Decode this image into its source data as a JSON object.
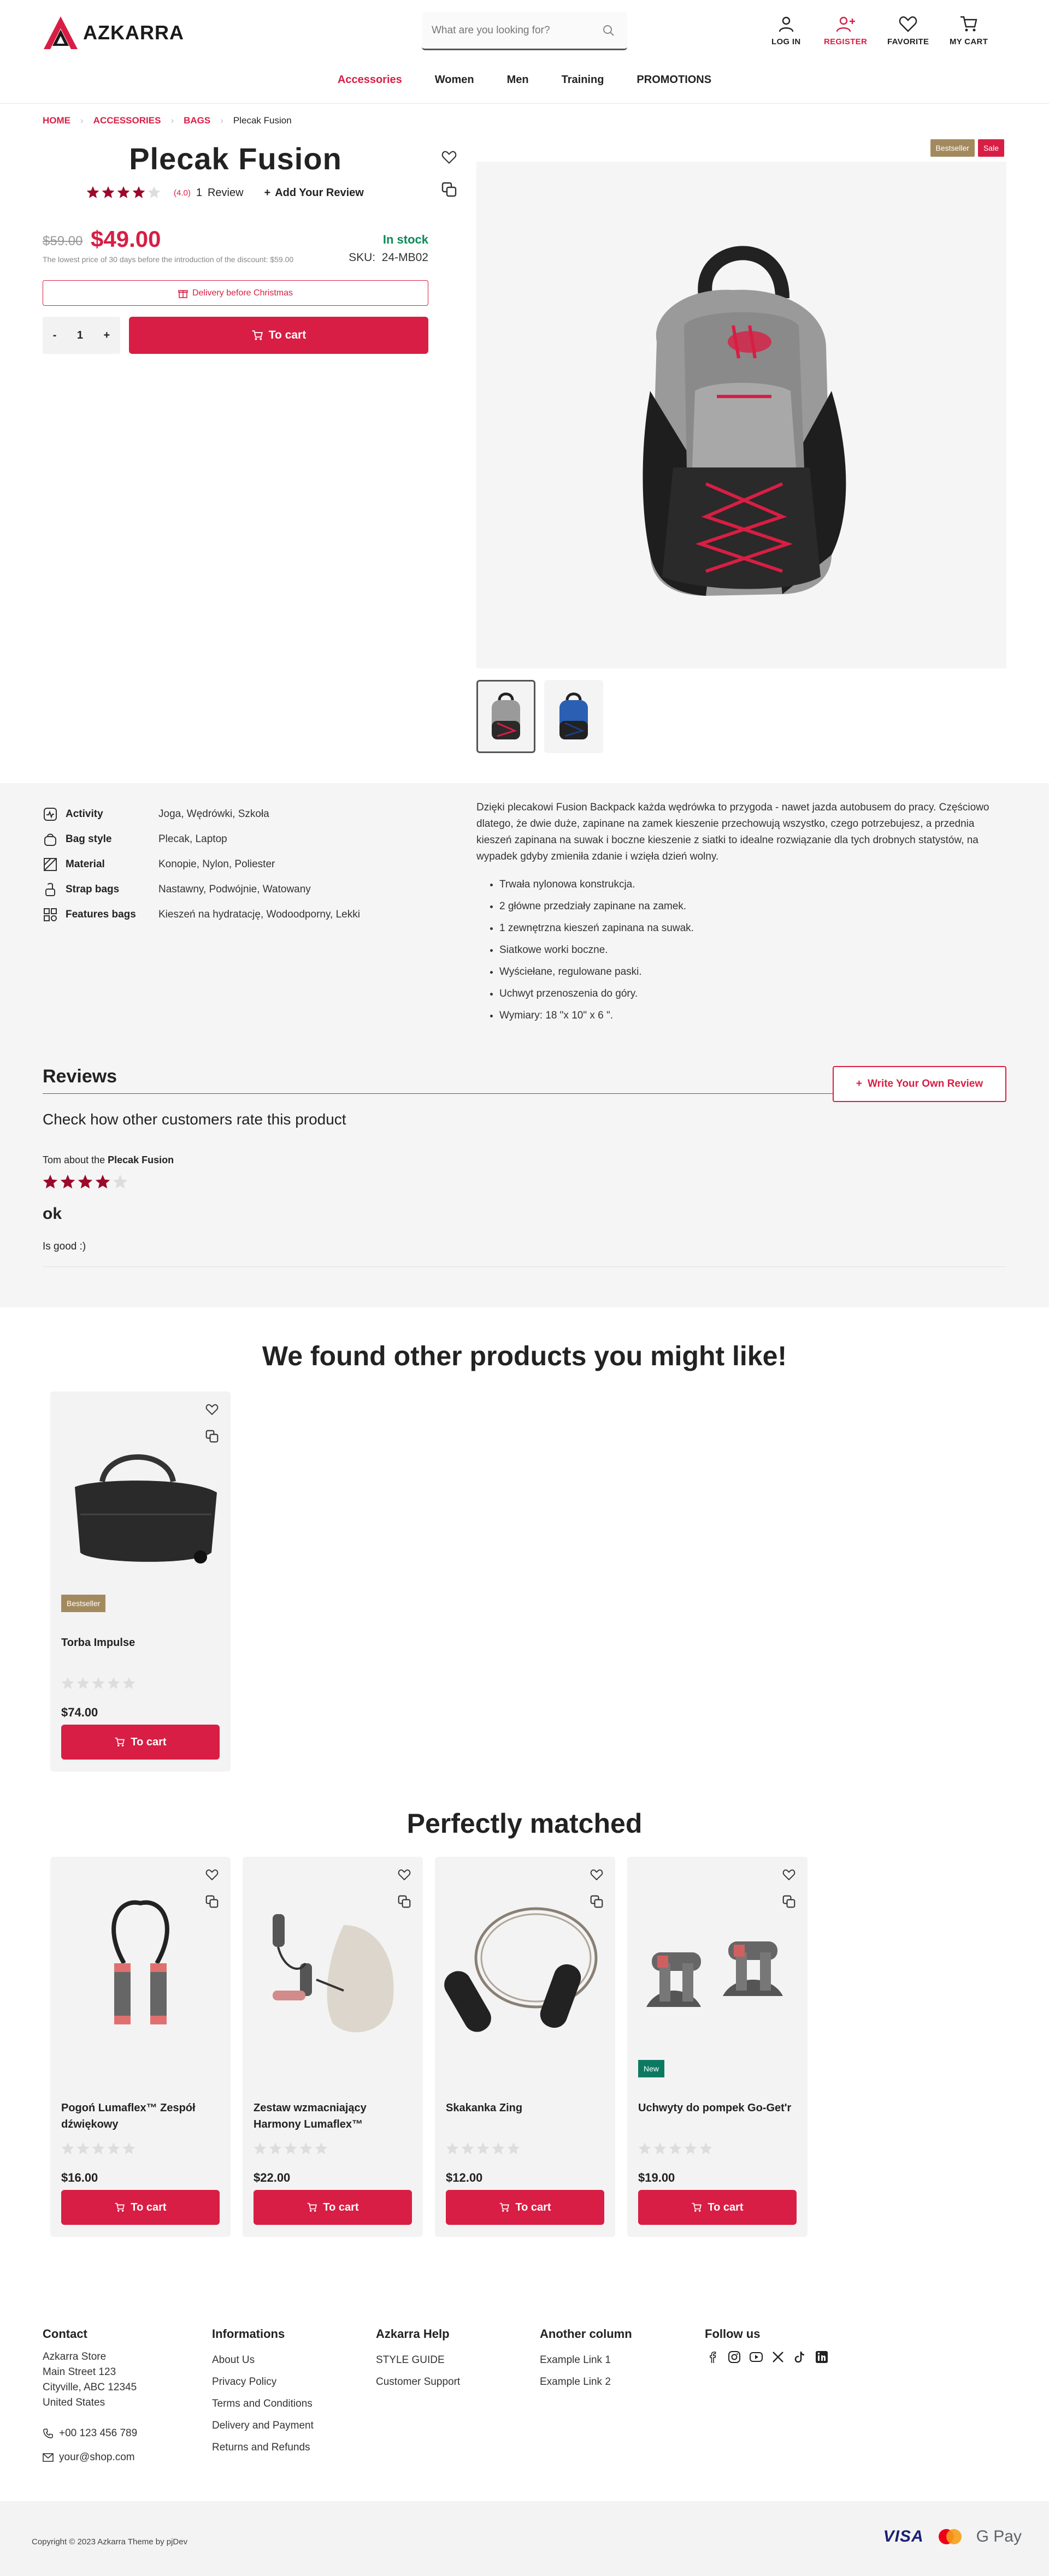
{
  "header": {
    "brand": "AZKARRA",
    "search_placeholder": "What are you looking for?",
    "actions": [
      {
        "label": "LOG IN",
        "icon": "user-icon"
      },
      {
        "label": "REGISTER",
        "icon": "user-plus-icon"
      },
      {
        "label": "FAVORITE",
        "icon": "heart-icon"
      },
      {
        "label": "MY CART",
        "icon": "cart-icon"
      }
    ],
    "nav": [
      "Accessories",
      "Women",
      "Men",
      "Training",
      "PROMOTIONS"
    ]
  },
  "breadcrumb": [
    "HOME",
    "ACCESSORIES",
    "BAGS",
    "Plecak Fusion"
  ],
  "product": {
    "title": "Plecak Fusion",
    "rating_value": "(4.0)",
    "rating_stars": 4,
    "review_count": "1",
    "review_word": "Review",
    "add_review": "Add Your Review",
    "old_price": "$59.00",
    "price": "$49.00",
    "stock": "In stock",
    "lowest_price_note": "The lowest price of 30 days before the introduction of the discount: $59.00",
    "sku_label": "SKU:",
    "sku": "24-MB02",
    "delivery_note": "Delivery before Christmas",
    "qty_minus": "-",
    "qty": "1",
    "qty_plus": "+",
    "to_cart": "To cart",
    "badges": [
      "Bestseller",
      "Sale"
    ]
  },
  "attributes": [
    {
      "key": "Activity",
      "value": "Joga, Wędrówki, Szkoła",
      "icon": "activity-icon"
    },
    {
      "key": "Bag style",
      "value": "Plecak, Laptop",
      "icon": "bag-icon"
    },
    {
      "key": "Material",
      "value": "Konopie, Nylon, Poliester",
      "icon": "material-icon"
    },
    {
      "key": "Strap bags",
      "value": "Nastawny, Podwójnie, Watowany",
      "icon": "strap-icon"
    },
    {
      "key": "Features bags",
      "value": "Kieszeń na hydratację, Wodoodporny, Lekki",
      "icon": "features-icon"
    }
  ],
  "description": {
    "text": "Dzięki plecakowi Fusion Backpack każda wędrówka to przygoda - nawet jazda autobusem do pracy. Częściowo dlatego, że dwie duże, zapinane na zamek kieszenie przechowują wszystko, czego potrzebujesz, a przednia kieszeń zapinana na suwak i boczne kieszenie z siatki to idealne rozwiązanie dla tych drobnych statystów, na wypadek gdyby zmieniła zdanie i wzięła dzień wolny.",
    "bullets": [
      "Trwała nylonowa konstrukcja.",
      "2 główne przedziały zapinane na zamek.",
      "1 zewnętrzna kieszeń zapinana na suwak.",
      "Siatkowe worki boczne.",
      "Wyściełane, regulowane paski.",
      "Uchwyt przenoszenia do góry.",
      "Wymiary: 18 \"x 10\" x 6 \"."
    ]
  },
  "reviews": {
    "title": "Reviews",
    "write_button": "Write Your Own Review",
    "subtitle": "Check how other customers rate this product",
    "items": [
      {
        "author": "Tom",
        "about": "about the",
        "product": "Plecak Fusion",
        "stars": 4,
        "title": "ok",
        "text": "Is good :)"
      }
    ]
  },
  "related": {
    "title": "We found other products you might like!",
    "items": [
      {
        "name": "Torba Impulse",
        "price": "$74.00",
        "badge": "Bestseller",
        "stars": 0,
        "button": "To cart"
      }
    ]
  },
  "matched": {
    "title": "Perfectly matched",
    "items": [
      {
        "name": "Pogoń Lumaflex™ Zespół dźwiękowy",
        "price": "$16.00",
        "badge": "",
        "stars": 0,
        "button": "To cart"
      },
      {
        "name": "Zestaw wzmacniający Harmony Lumaflex™",
        "price": "$22.00",
        "badge": "",
        "stars": 0,
        "button": "To cart"
      },
      {
        "name": "Skakanka Zing",
        "price": "$12.00",
        "badge": "",
        "stars": 0,
        "button": "To cart"
      },
      {
        "name": "Uchwyty do pompek Go-Get'r",
        "price": "$19.00",
        "badge": "New",
        "stars": 0,
        "button": "To cart"
      }
    ]
  },
  "footer": {
    "contact": {
      "title": "Contact",
      "lines": [
        "Azkarra Store",
        "Main Street 123",
        "Cityville, ABC 12345",
        "United States"
      ],
      "phone": "+00 123 456 789",
      "email": "your@shop.com"
    },
    "informations": {
      "title": "Informations",
      "links": [
        "About Us",
        "Privacy Policy",
        "Terms and Conditions",
        "Delivery and Payment",
        "Returns and Refunds"
      ]
    },
    "help": {
      "title": "Azkarra Help",
      "links": [
        "STYLE GUIDE",
        "Customer Support"
      ]
    },
    "another": {
      "title": "Another column",
      "links": [
        "Example Link 1",
        "Example Link 2"
      ]
    },
    "follow": {
      "title": "Follow us",
      "icons": [
        "facebook-icon",
        "instagram-icon",
        "youtube-icon",
        "x-icon",
        "tiktok-icon",
        "linkedin-icon"
      ]
    },
    "copyright": "Copyright © 2023 Azkarra Theme by pjDev",
    "payments": [
      "VISA",
      "mastercard",
      "G Pay"
    ]
  },
  "colors": {
    "accent": "#d81e44",
    "stock": "#0a8a57",
    "bestseller": "#a38a5e",
    "new": "#0c7a62",
    "star": "#9b0a2a"
  }
}
